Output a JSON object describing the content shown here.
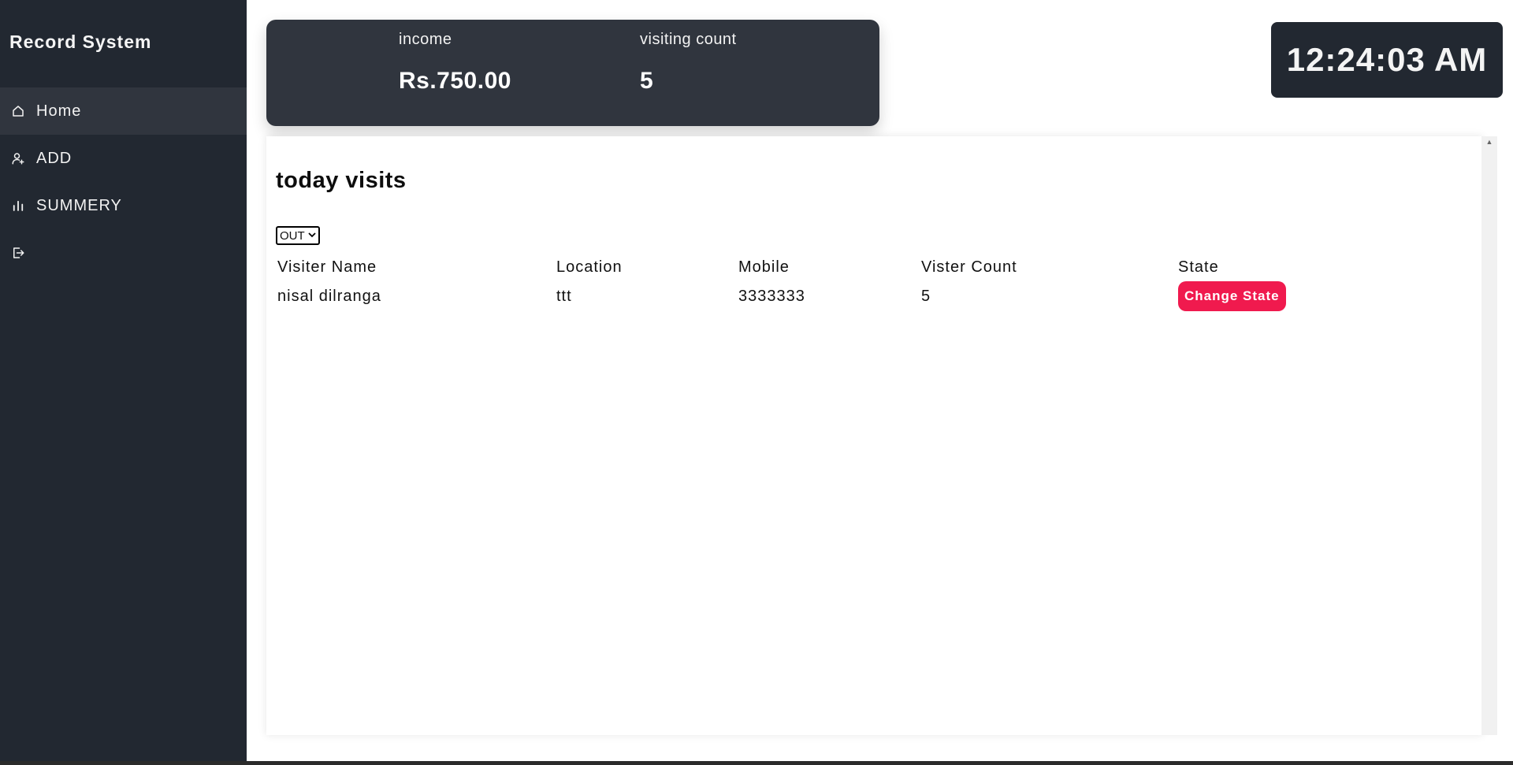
{
  "sidebar": {
    "brand": "Record System",
    "items": [
      {
        "label": "Home",
        "icon": "home-icon"
      },
      {
        "label": "ADD",
        "icon": "add-user-icon"
      },
      {
        "label": "SUMMERY",
        "icon": "bar-chart-icon"
      },
      {
        "label": "",
        "icon": "logout-icon"
      }
    ]
  },
  "stats": {
    "income_label": "income",
    "income_value": "Rs.750.00",
    "count_label": "visiting count",
    "count_value": "5"
  },
  "clock": {
    "time": "12:24:03 AM"
  },
  "panel": {
    "title": "today visits",
    "filter": {
      "selected": "OUT"
    },
    "table": {
      "headers": [
        "Visiter Name",
        "Location",
        "Mobile",
        "Vister Count",
        "State"
      ],
      "rows": [
        {
          "name": "nisal dilranga",
          "location": "ttt",
          "mobile": "3333333",
          "count": "5",
          "action": "Change State"
        }
      ]
    }
  },
  "colors": {
    "sidebar_bg": "#222831",
    "card_bg": "#30353e",
    "accent_button": "#f01a4e"
  }
}
